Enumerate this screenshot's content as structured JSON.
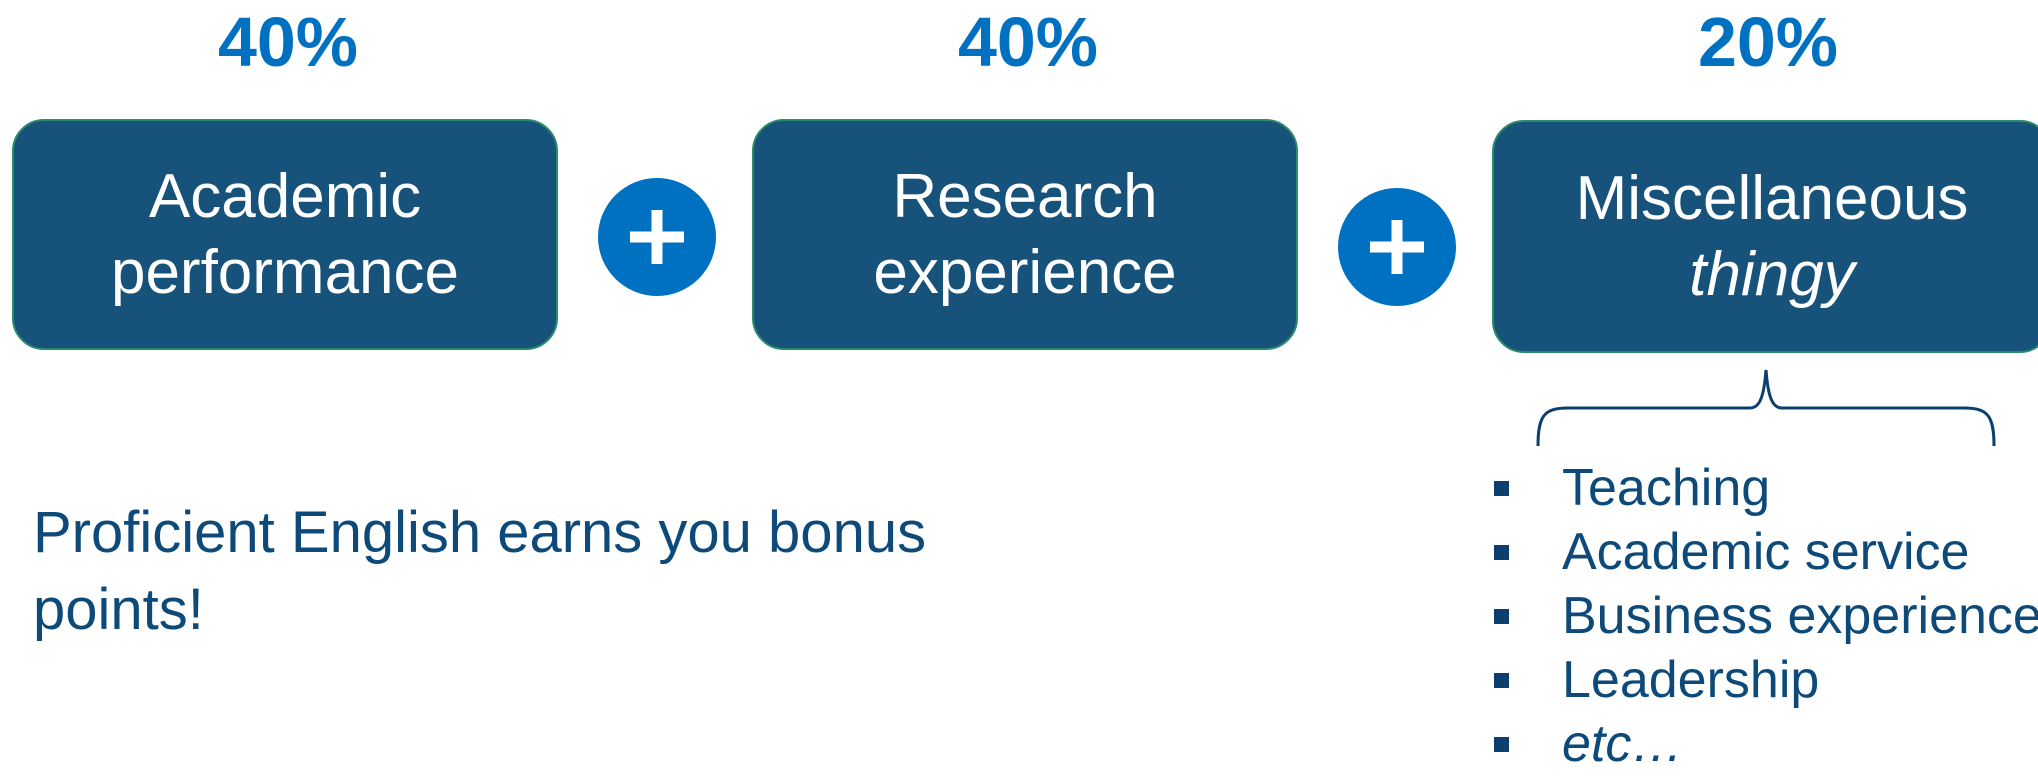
{
  "weights": [
    {
      "percent": "40%",
      "line1": "Academic",
      "line2": "performance",
      "italic_line2": false
    },
    {
      "percent": "40%",
      "line1": "Research",
      "line2": "experience",
      "italic_line2": false
    },
    {
      "percent": "20%",
      "line1": "Miscellaneous",
      "line2": "thingy",
      "italic_line2": true
    }
  ],
  "operator_icon": "plus-icon",
  "bonus_text": "Proficient English earns you bonus points!",
  "misc_items": [
    {
      "label": "Teaching",
      "italic": false
    },
    {
      "label": "Academic service",
      "italic": false
    },
    {
      "label": "Business experience",
      "italic": false
    },
    {
      "label": "Leadership",
      "italic": false
    },
    {
      "label": "etc…",
      "italic": true
    }
  ],
  "colors": {
    "percent_text": "#0070c0",
    "box_fill": "#17527b",
    "plus_fill": "#0070c0",
    "body_text": "#0d4a7a"
  }
}
